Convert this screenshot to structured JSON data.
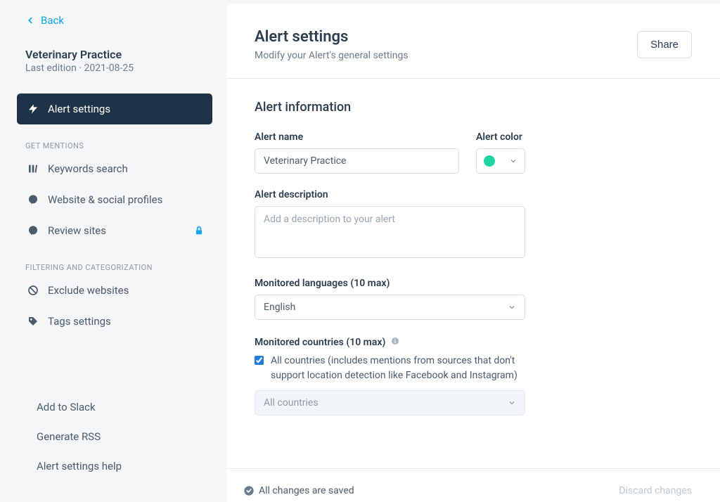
{
  "sidebar": {
    "back_label": "Back",
    "alert_title": "Veterinary Practice",
    "last_edition_label": "Last edition · 2021-08-25",
    "nav": {
      "alert_settings": "Alert settings"
    },
    "section_get_mentions": "GET MENTIONS",
    "items_get_mentions": {
      "keywords_search": "Keywords search",
      "website_social": "Website & social profiles",
      "review_sites": "Review sites"
    },
    "section_filtering": "FILTERING AND CATEGORIZATION",
    "items_filtering": {
      "exclude_websites": "Exclude websites",
      "tags_settings": "Tags settings"
    },
    "bottom_links": {
      "add_to_slack": "Add to Slack",
      "generate_rss": "Generate RSS",
      "alert_settings_help": "Alert settings help"
    }
  },
  "header": {
    "title": "Alert settings",
    "subtitle": "Modify your Alert's general settings",
    "share_button": "Share"
  },
  "form": {
    "section_title": "Alert information",
    "alert_name_label": "Alert name",
    "alert_name_value": "Veterinary Practice",
    "alert_color_label": "Alert color",
    "alert_color_value": "#1ed6a4",
    "alert_description_label": "Alert description",
    "alert_description_placeholder": "Add a description to your alert",
    "monitored_languages_label": "Monitored languages (10 max)",
    "monitored_languages_value": "English",
    "monitored_countries_label": "Monitored countries (10 max)",
    "all_countries_checkbox_label": "All countries (includes mentions from sources that don't support location detection like Facebook and Instagram)",
    "countries_select_disabled_value": "All countries"
  },
  "footer": {
    "saved_status": "All changes are saved",
    "discard_link": "Discard changes"
  }
}
